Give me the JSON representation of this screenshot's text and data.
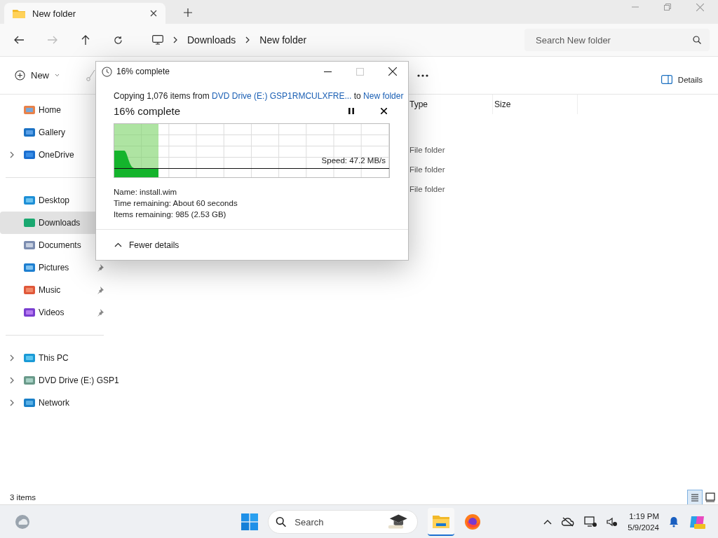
{
  "tab": {
    "title": "New folder"
  },
  "address": {
    "crumbs": [
      "Downloads",
      "New folder"
    ]
  },
  "search": {
    "placeholder": "Search New folder"
  },
  "toolbar": {
    "new_label": "New",
    "details_label": "Details"
  },
  "sidebar": {
    "groups": [
      [
        {
          "label": "Home",
          "selected": false,
          "expandable": false,
          "pinned": false
        },
        {
          "label": "Gallery",
          "selected": false,
          "expandable": false,
          "pinned": false
        },
        {
          "label": "OneDrive",
          "selected": false,
          "expandable": true,
          "pinned": false
        }
      ],
      [
        {
          "label": "Desktop",
          "selected": false,
          "expandable": false,
          "pinned": false
        },
        {
          "label": "Downloads",
          "selected": true,
          "expandable": false,
          "pinned": false
        },
        {
          "label": "Documents",
          "selected": false,
          "expandable": false,
          "pinned": false
        },
        {
          "label": "Pictures",
          "selected": false,
          "expandable": false,
          "pinned": true
        },
        {
          "label": "Music",
          "selected": false,
          "expandable": false,
          "pinned": true
        },
        {
          "label": "Videos",
          "selected": false,
          "expandable": false,
          "pinned": true
        }
      ],
      [
        {
          "label": "This PC",
          "selected": false,
          "expandable": true,
          "pinned": false
        },
        {
          "label": "DVD Drive (E:) GSP1",
          "selected": false,
          "expandable": true,
          "pinned": false
        },
        {
          "label": "Network",
          "selected": false,
          "expandable": true,
          "pinned": false
        }
      ]
    ]
  },
  "columns": [
    "Type",
    "Size"
  ],
  "rows": [
    {
      "type": "File folder"
    },
    {
      "type": "File folder"
    },
    {
      "type": "File folder"
    }
  ],
  "status_bar": {
    "count": "3 items"
  },
  "dialog": {
    "title": "16% complete",
    "summary": "Copying 1,076 items from ",
    "source": "DVD Drive (E:) GSP1RMCULXFRE...",
    "joiner": " to ",
    "destination": "New folder",
    "heading": "16% complete",
    "level": 0.16,
    "speed": "Speed: 47.2 MB/s",
    "details": [
      {
        "label": "Name:",
        "value": "install.wim"
      },
      {
        "label": "Time remaining:",
        "value": "About 60 seconds"
      },
      {
        "label": "Items remaining:",
        "value": "985 (2.53 GB)"
      }
    ],
    "toggle": "Fewer details"
  },
  "taskbar": {
    "search_placeholder": "Search",
    "time": "1:19 PM",
    "date": "5/9/2024"
  }
}
